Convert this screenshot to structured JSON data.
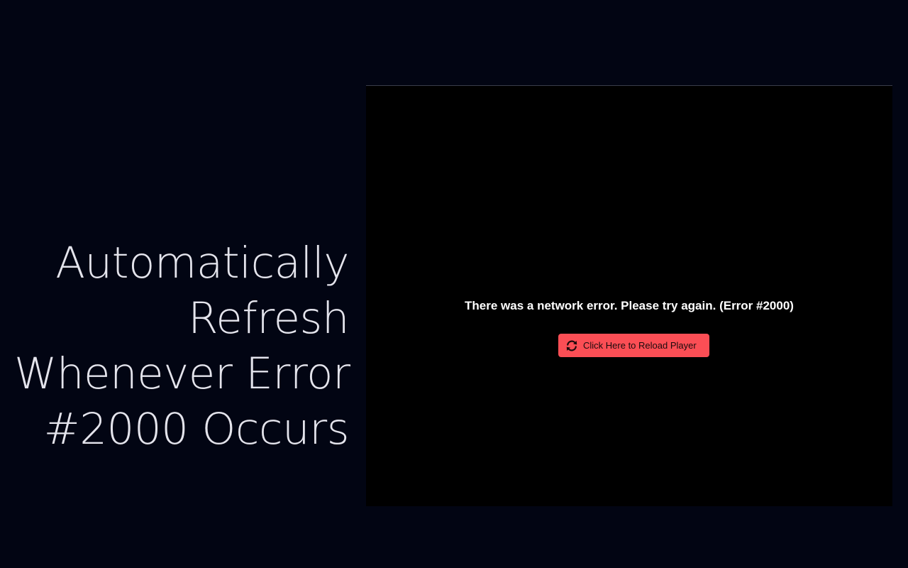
{
  "headline": {
    "lines": [
      "Automatically",
      "Refresh",
      "Whenever Error",
      "#2000 Occurs"
    ]
  },
  "player": {
    "error_message": "There was a network error. Please try again. (Error #2000)",
    "reload_button": {
      "label": "Click Here to Reload Player",
      "icon": "refresh-icon"
    }
  },
  "colors": {
    "page_background": "#020513",
    "player_background": "#000000",
    "button_background": "#fb4e55",
    "headline_text": "#e4e4ec"
  }
}
